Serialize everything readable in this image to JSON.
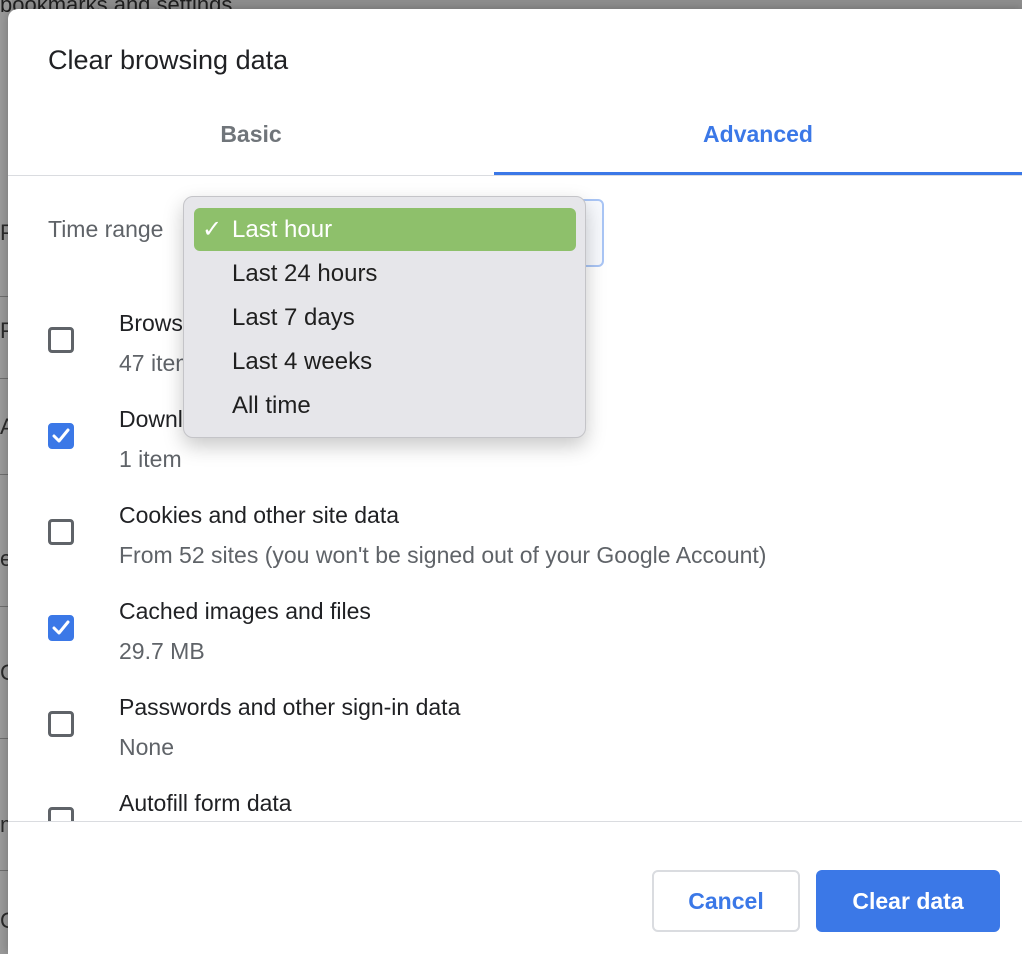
{
  "background": {
    "partial_text": "bookmarks and settings",
    "side_letters": [
      "P",
      "P",
      "A",
      "e",
      "C",
      "m",
      "C"
    ]
  },
  "dialog": {
    "title": "Clear browsing data",
    "tabs": [
      {
        "label": "Basic",
        "active": false
      },
      {
        "label": "Advanced",
        "active": true
      }
    ],
    "time_range": {
      "label": "Time range",
      "selected": "Last hour"
    },
    "options": [
      {
        "title": "Browsing history",
        "subtitle": "47 items",
        "checked": false
      },
      {
        "title": "Download history",
        "subtitle": "1 item",
        "checked": true
      },
      {
        "title": "Cookies and other site data",
        "subtitle": "From 52 sites (you won't be signed out of your Google Account)",
        "checked": false
      },
      {
        "title": "Cached images and files",
        "subtitle": "29.7 MB",
        "checked": true
      },
      {
        "title": "Passwords and other sign-in data",
        "subtitle": "None",
        "checked": false
      },
      {
        "title": "Autofill form data",
        "subtitle": "",
        "checked": false
      }
    ],
    "buttons": {
      "cancel": "Cancel",
      "clear": "Clear data"
    }
  },
  "dropdown": {
    "check_glyph": "✓",
    "items": [
      {
        "label": "Last hour",
        "selected": true
      },
      {
        "label": "Last 24 hours",
        "selected": false
      },
      {
        "label": "Last 7 days",
        "selected": false
      },
      {
        "label": "Last 4 weeks",
        "selected": false
      },
      {
        "label": "All time",
        "selected": false
      }
    ]
  },
  "colors": {
    "accent": "#3b78e7",
    "selected_item": "#8ec06b",
    "dropdown_bg": "#e6e6ea"
  }
}
